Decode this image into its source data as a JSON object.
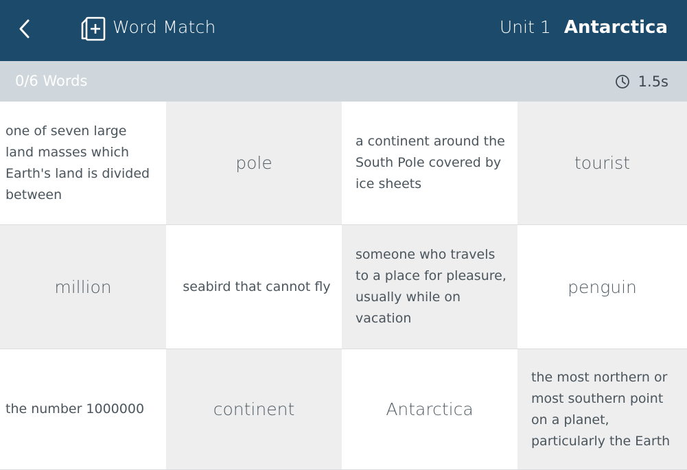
{
  "header": {
    "back_icon": "chevron-left-icon",
    "app_icon": "add-card-icon",
    "app_title": "Word Match",
    "unit": "Unit 1",
    "topic": "Antarctica"
  },
  "status": {
    "progress": "0/6 Words",
    "timer_icon": "clock-icon",
    "timer": "1.5s"
  },
  "cards": [
    {
      "kind": "def",
      "text": "one of seven large land masses which Earth's land is divided between"
    },
    {
      "kind": "word",
      "text": "pole"
    },
    {
      "kind": "def",
      "text": "a continent around the South Pole covered by ice sheets"
    },
    {
      "kind": "word",
      "text": "tourist"
    },
    {
      "kind": "word",
      "text": "million"
    },
    {
      "kind": "def",
      "text": "seabird that cannot fly"
    },
    {
      "kind": "def",
      "text": "someone who travels to a place for pleasure, usually while on vacation"
    },
    {
      "kind": "word",
      "text": "penguin"
    },
    {
      "kind": "def",
      "text": "the number 1000000"
    },
    {
      "kind": "word",
      "text": "continent"
    },
    {
      "kind": "word",
      "text": "Antarctica"
    },
    {
      "kind": "def",
      "text": "the most northern or most southern point on a planet, particularly the Earth"
    }
  ],
  "colors": {
    "header_bg": "#1c4a6a",
    "status_bg": "#cfd7dc",
    "card_grey": "#eeeeee",
    "card_white": "#ffffff"
  }
}
